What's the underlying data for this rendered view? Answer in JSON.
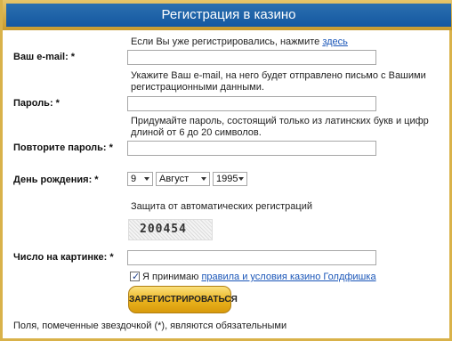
{
  "window": {
    "title": "Регистрация в казино"
  },
  "already_registered": {
    "text": "Если Вы уже регистрировались, нажмите",
    "link": "здесь"
  },
  "email": {
    "label": "Ваш e-mail: *",
    "value": "",
    "hint": "Укажите Ваш e-mail, на него будет отправлено письмо с Вашими регистрационными данными."
  },
  "password": {
    "label": "Пароль: *",
    "value": "",
    "hint": "Придумайте пароль, состоящий только из латинских букв и цифр длиной от 6 до 20 символов."
  },
  "password_repeat": {
    "label": "Повторите пароль: *",
    "value": ""
  },
  "birthday": {
    "label": "День рождения: *",
    "day": "9",
    "month": "Август",
    "year": "1995"
  },
  "captcha": {
    "caption": "Защита от автоматических регистраций",
    "code": "200454",
    "label": "Число на картинке: *",
    "value": ""
  },
  "terms": {
    "checked": true,
    "prefix": "Я принимаю",
    "link": "правила и условия казино Голдфишка"
  },
  "submit_label": "ЗАРЕГИСТРИРОВАТЬСЯ",
  "footnote": "Поля, помеченные звездочкой (*), являются обязательными",
  "colors": {
    "title_bg": "#1558a0",
    "frame": "#d9b24a",
    "button": "#e9b21d",
    "link": "#1a56b8"
  },
  "icons": {
    "dropdown": "chevron-down-icon",
    "checkbox": "checkmark-icon"
  }
}
